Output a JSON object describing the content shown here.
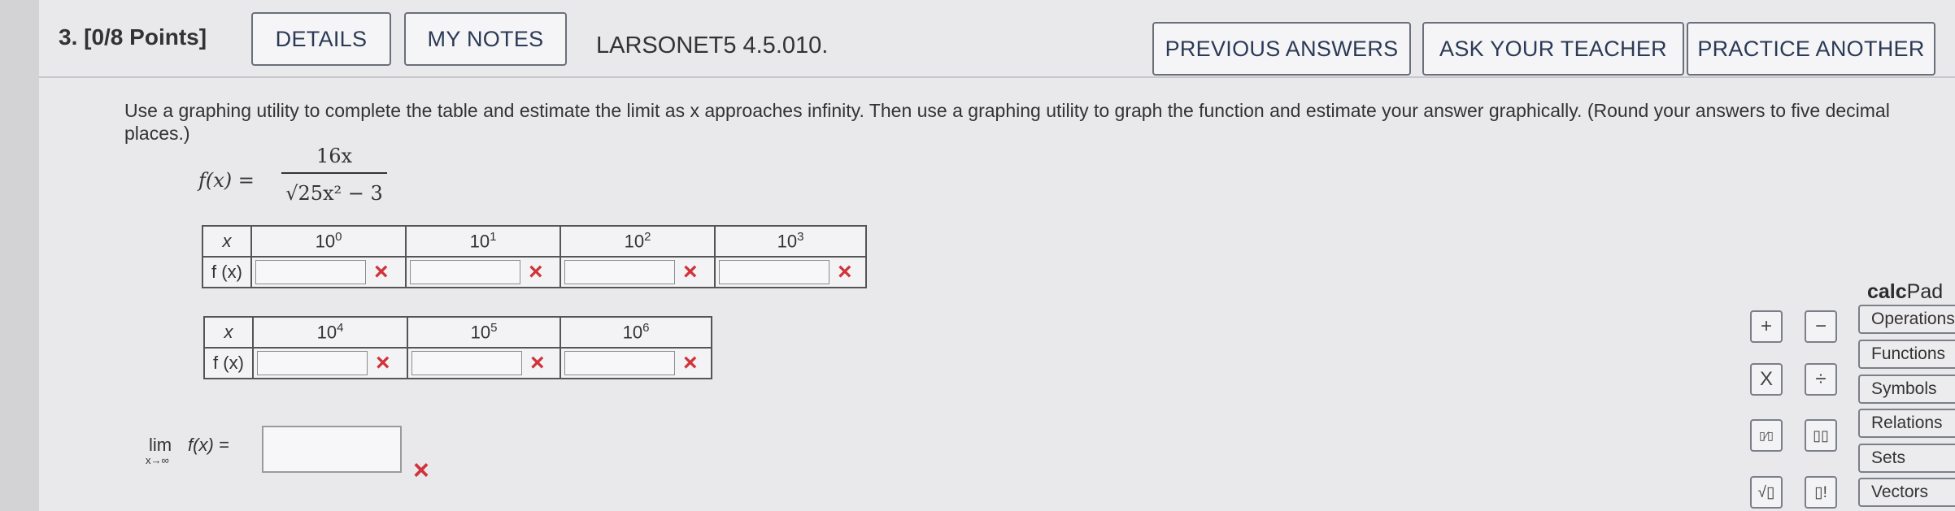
{
  "header": {
    "question": "3.  [0/8 Points]",
    "details": "DETAILS",
    "my_notes": "MY NOTES",
    "code": "LARSONET5 4.5.010.",
    "previous_answers": "PREVIOUS ANSWERS",
    "ask_teacher": "ASK YOUR TEACHER",
    "practice_another": "PRACTICE ANOTHER"
  },
  "instructions": "Use a graphing utility to complete the table and estimate the limit as x approaches infinity. Then use a graphing utility to graph the function and estimate your answer graphically. (Round your answers to five decimal places.)",
  "function": {
    "lhs": "f(x) = ",
    "numerator": "16x",
    "denominator": "√25x² − 3"
  },
  "table1": {
    "row_x": "x",
    "row_f": "f (x)",
    "exponents": [
      "0",
      "1",
      "2",
      "3"
    ],
    "base": "10"
  },
  "table2": {
    "row_x": "x",
    "row_f": "f (x)",
    "exponents": [
      "4",
      "5",
      "6"
    ],
    "base": "10"
  },
  "limit": {
    "lim": "lim",
    "sub": "x→∞",
    "expr": "f(x) ="
  },
  "mark": "×",
  "calcpad": {
    "title_calc": "calc",
    "title_pad": "Pad",
    "keys": [
      "+",
      "−",
      "X",
      "÷",
      "▯⁄▯",
      "▯▯",
      "√▯",
      "▯!"
    ],
    "tabs": [
      "Operations",
      "Functions",
      "Symbols",
      "Relations",
      "Sets",
      "Vectors"
    ]
  },
  "colors": {
    "error": "#d0343a",
    "button_text": "#2b3a55"
  }
}
